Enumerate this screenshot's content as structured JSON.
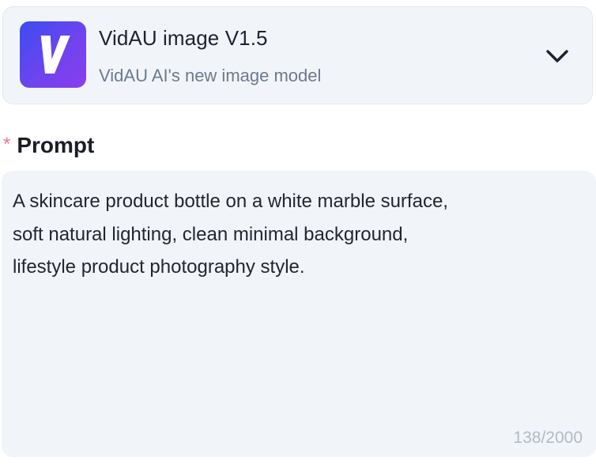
{
  "model": {
    "name": "VidAU image V1.5",
    "description": "VidAU AI's new image model",
    "logo_letter": "V",
    "logo_colors": [
      "#3b4cf2",
      "#8b3cf0"
    ],
    "dropdown_icon": "chevron-down-icon"
  },
  "prompt": {
    "required_marker": "*",
    "label": "Prompt",
    "value": "A skincare product bottle on a white marble surface,\nsoft natural lighting, clean minimal background,\nlifestyle product photography style.",
    "char_count": "138/2000"
  }
}
